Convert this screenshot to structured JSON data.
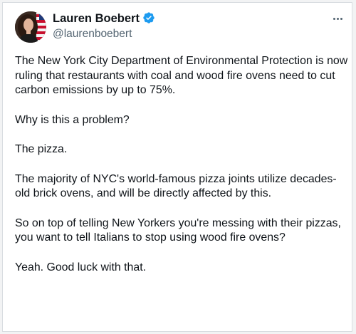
{
  "tweet": {
    "author": {
      "name": "Lauren Boebert",
      "handle": "@laurenboebert",
      "avatar_icon": "profile-photo",
      "verified_icon": "verified-badge-icon",
      "verified_color": "#1d9bf0"
    },
    "more_icon": "more-options-icon",
    "paragraphs": [
      "The New York City Department of Environmental Protection is now ruling that restaurants with coal and wood fire ovens need to cut carbon emissions by up to 75%.",
      "Why is this a problem?",
      "The pizza.",
      "The majority of NYC's world-famous pizza joints utilize decades-old brick ovens, and will be directly affected by this.",
      "So on top of telling New Yorkers you're messing with their pizzas, you want to tell Italians to stop using wood fire ovens?",
      "Yeah. Good luck with that."
    ]
  },
  "colors": {
    "text_primary": "#0f1419",
    "text_secondary": "#536471",
    "background": "#ffffff",
    "accent": "#1d9bf0"
  }
}
